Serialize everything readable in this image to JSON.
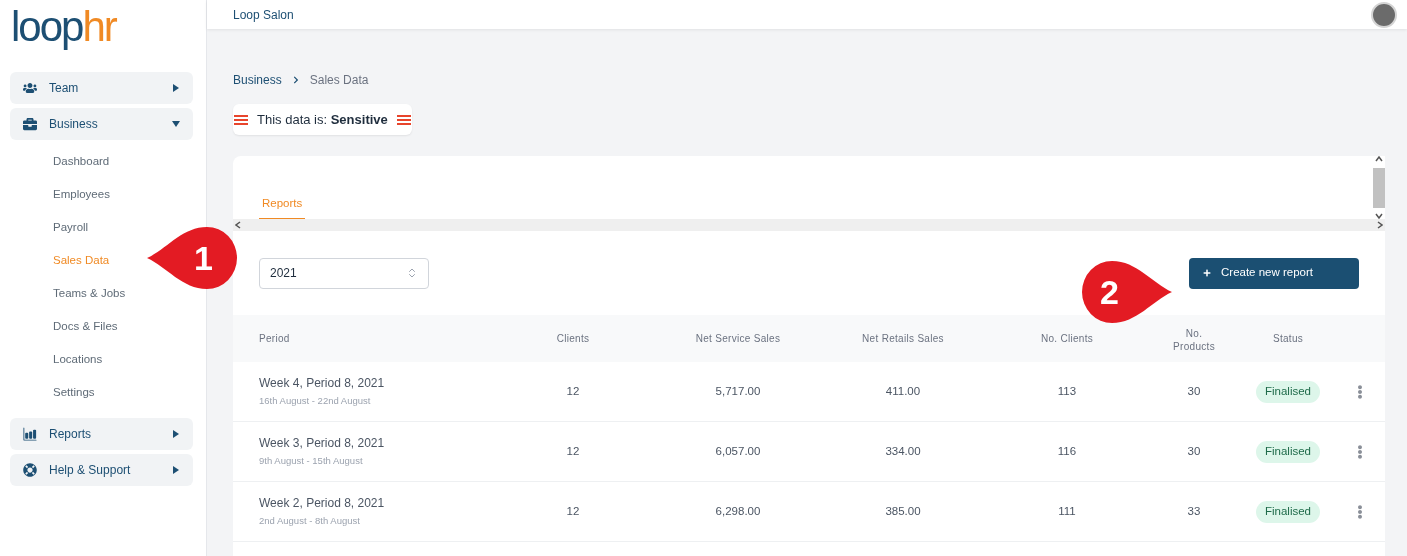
{
  "logo": {
    "part_1": "loop",
    "part_2": "hr"
  },
  "sidebar": {
    "items": [
      {
        "label": "Team",
        "expanded": false
      },
      {
        "label": "Business",
        "expanded": true,
        "children": [
          {
            "label": "Dashboard",
            "selected": false
          },
          {
            "label": "Employees",
            "selected": false
          },
          {
            "label": "Payroll",
            "selected": false
          },
          {
            "label": "Sales Data",
            "selected": true
          },
          {
            "label": "Teams & Jobs",
            "selected": false
          },
          {
            "label": "Docs & Files",
            "selected": false
          },
          {
            "label": "Locations",
            "selected": false
          },
          {
            "label": "Settings",
            "selected": false
          }
        ]
      },
      {
        "label": "Reports",
        "expanded": false
      },
      {
        "label": "Help & Support",
        "expanded": false
      }
    ]
  },
  "header": {
    "title": "Loop Salon"
  },
  "breadcrumb": [
    "Business",
    "Sales Data"
  ],
  "sensitivity": "This data is: **Sensitive**",
  "tabs": [
    {
      "label": "Reports",
      "selected": true
    }
  ],
  "year_select": {
    "value": "2021"
  },
  "create_button": {
    "label": "Create new report"
  },
  "table": {
    "columns": [
      "Period",
      "Clients",
      "Net Service Sales",
      "Net Retails Sales",
      "No. Clients",
      "No. Products",
      "Status"
    ],
    "rows": [
      {
        "period": "Week 4, Period 8, 2021",
        "dates": "16th August - 22nd August",
        "clients": "12",
        "net_service": "5,717.00",
        "net_retail": "411.00",
        "no_clients": "113",
        "no_products": "30",
        "status": "Finalised"
      },
      {
        "period": "Week 3, Period 8, 2021",
        "dates": "9th August - 15th August",
        "clients": "12",
        "net_service": "6,057.00",
        "net_retail": "334.00",
        "no_clients": "116",
        "no_products": "30",
        "status": "Finalised"
      },
      {
        "period": "Week 2, Period 8, 2021",
        "dates": "2nd August - 8th August",
        "clients": "12",
        "net_service": "6,298.00",
        "net_retail": "385.00",
        "no_clients": "111",
        "no_products": "33",
        "status": "Finalised"
      }
    ]
  },
  "callouts": [
    "1",
    "2"
  ]
}
